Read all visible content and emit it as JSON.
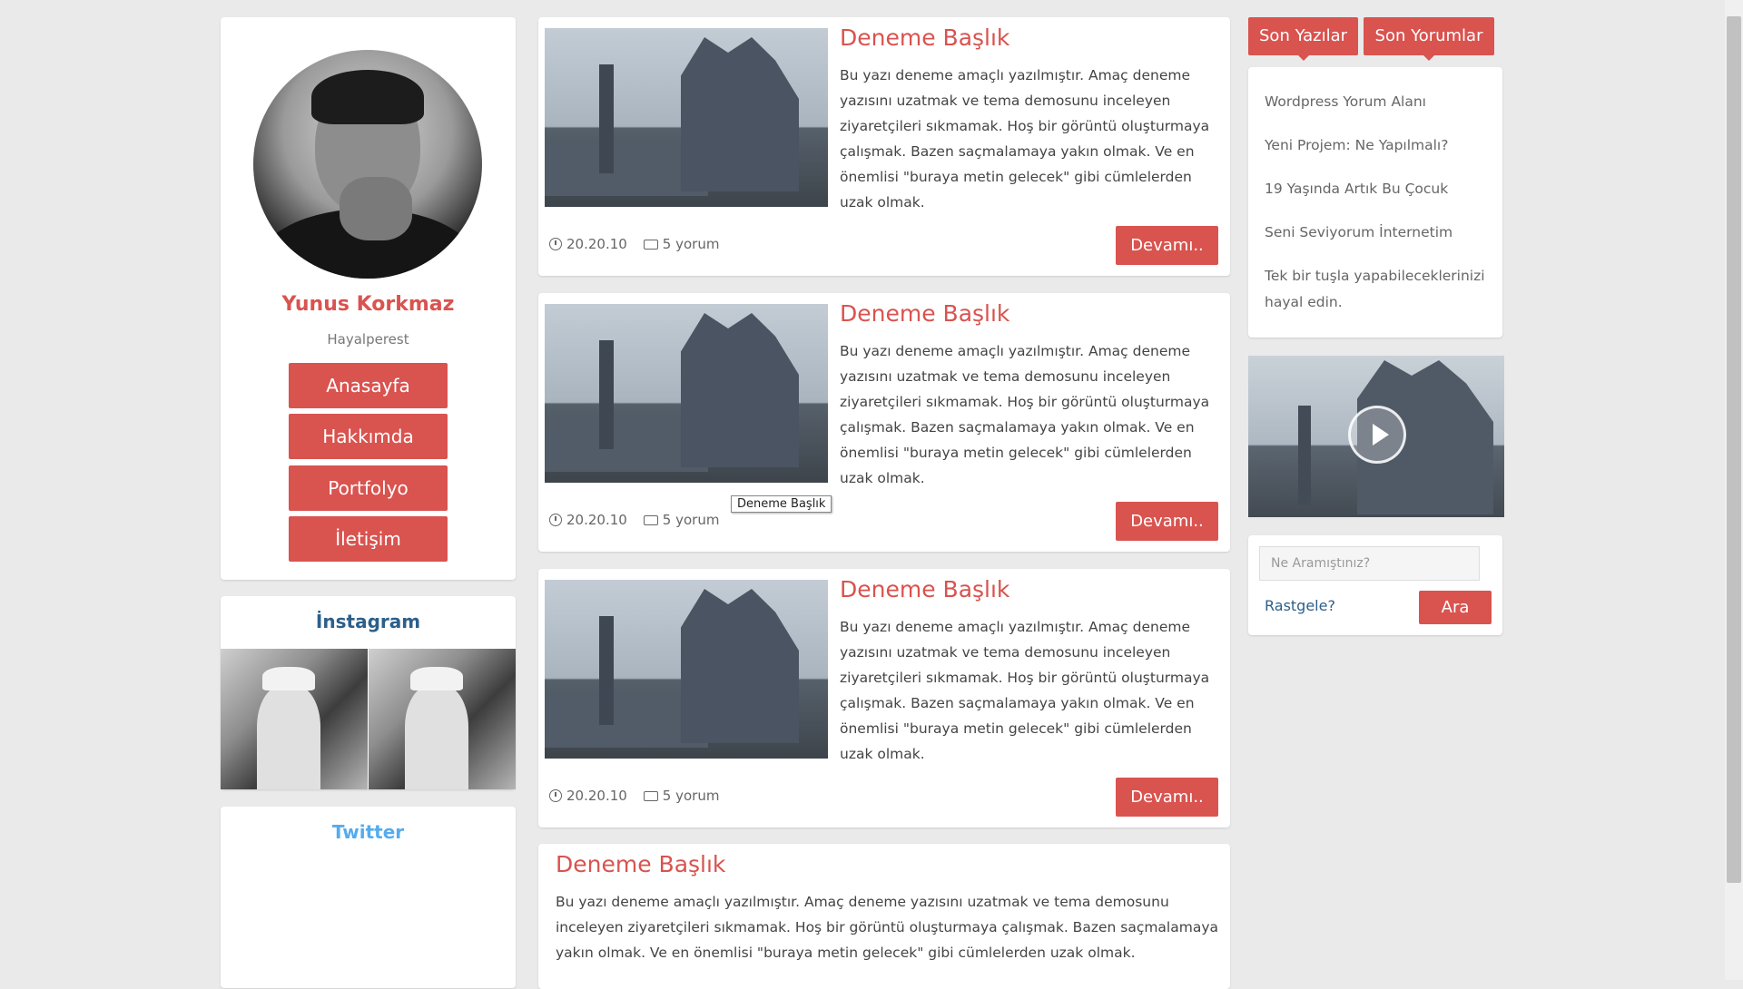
{
  "profile": {
    "name": "Yunus Korkmaz",
    "tagline": "Hayalperest",
    "nav": [
      "Anasayfa",
      "Hakkımda",
      "Portfolyo",
      "İletişim"
    ]
  },
  "instagram": {
    "title": "İnstagram"
  },
  "twitter": {
    "title": "Twitter"
  },
  "posts": [
    {
      "title": "Deneme Başlık",
      "text": "Bu yazı deneme amaçlı yazılmıştır. Amaç deneme yazısını uzatmak ve tema demosunu inceleyen ziyaretçileri sıkmamak. Hoş bir görüntü oluşturmaya çalışmak. Bazen saçmalamaya yakın olmak. Ve en önemlisi \"buraya metin gelecek\" gibi cümlelerden uzak olmak.",
      "date": "20.20.10",
      "comments": "5 yorum",
      "more": "Devamı.."
    },
    {
      "title": "Deneme Başlık",
      "text": "Bu yazı deneme amaçlı yazılmıştır. Amaç deneme yazısını uzatmak ve tema demosunu inceleyen ziyaretçileri sıkmamak. Hoş bir görüntü oluşturmaya çalışmak. Bazen saçmalamaya yakın olmak. Ve en önemlisi \"buraya metin gelecek\" gibi cümlelerden uzak olmak.",
      "date": "20.20.10",
      "comments": "5 yorum",
      "more": "Devamı.."
    },
    {
      "title": "Deneme Başlık",
      "text": "Bu yazı deneme amaçlı yazılmıştır. Amaç deneme yazısını uzatmak ve tema demosunu inceleyen ziyaretçileri sıkmamak. Hoş bir görüntü oluşturmaya çalışmak. Bazen saçmalamaya yakın olmak. Ve en önemlisi \"buraya metin gelecek\" gibi cümlelerden uzak olmak.",
      "date": "20.20.10",
      "comments": "5 yorum",
      "more": "Devamı.."
    },
    {
      "title": "Deneme Başlık",
      "text": "Bu yazı deneme amaçlı yazılmıştır. Amaç deneme yazısını uzatmak ve tema demosunu inceleyen ziyaretçileri sıkmamak. Hoş bir görüntü oluşturmaya çalışmak. Bazen saçmalamaya yakın olmak. Ve en önemlisi \"buraya metin gelecek\" gibi cümlelerden uzak olmak."
    }
  ],
  "tooltip": "Deneme Başlık",
  "sidebar": {
    "tabs": [
      "Son Yazılar",
      "Son Yorumlar"
    ],
    "recent": [
      "Wordpress Yorum Alanı",
      "Yeni Projem: Ne Yapılmalı?",
      "19 Yaşında Artık Bu Çocuk",
      "Seni Seviyorum İnternetim",
      "Tek bir tuşla yapabileceklerinizi hayal edin."
    ]
  },
  "search": {
    "placeholder": "Ne Aramıştınız?",
    "random": "Rastgele?",
    "button": "Ara"
  },
  "colors": {
    "accent": "#d9534f",
    "instagram_title": "#2c5f8a",
    "twitter_title": "#55acee",
    "page_bg": "#eaeaea"
  },
  "icons": [
    "clock-icon",
    "comment-icon",
    "play-icon"
  ]
}
